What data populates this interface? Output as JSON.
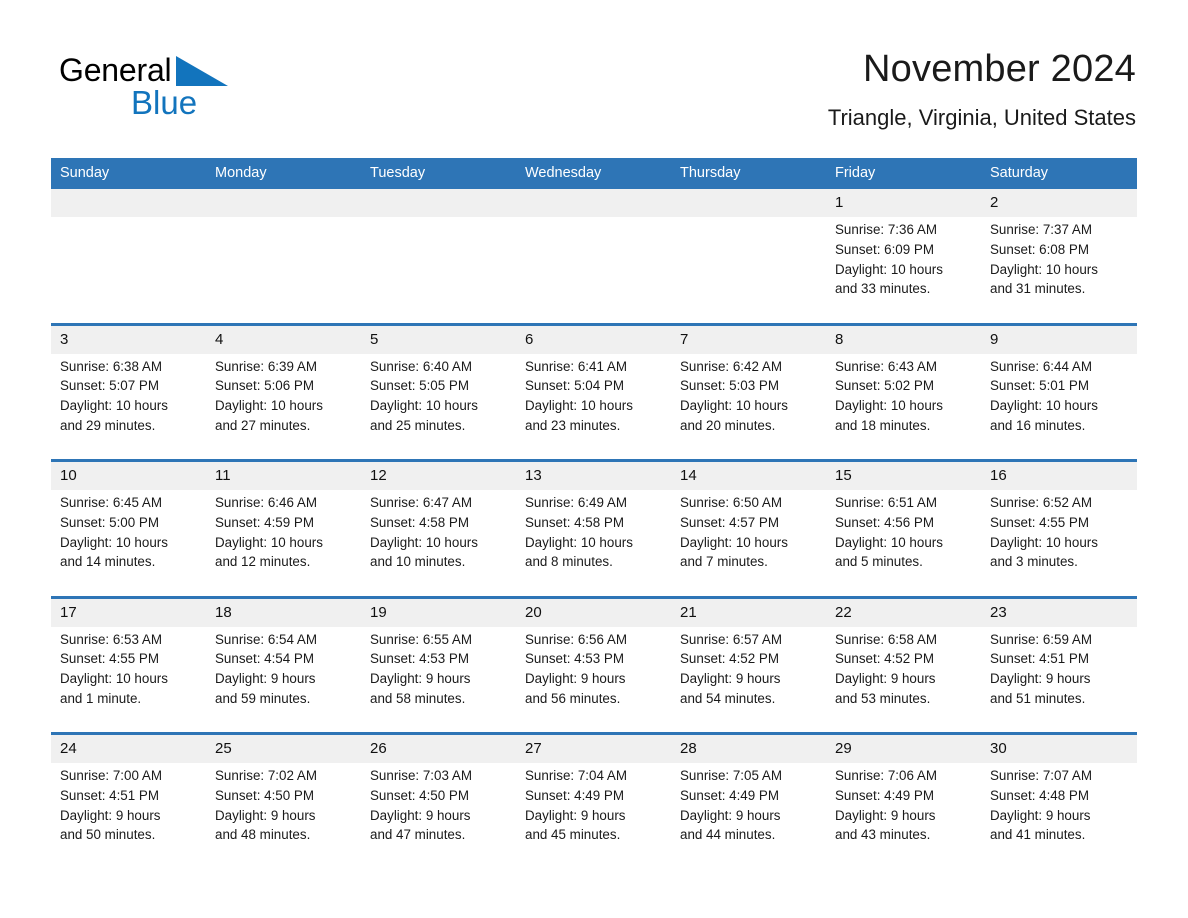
{
  "brand": {
    "name_part1": "General",
    "name_part2": "Blue",
    "triangle_icon": "blue-right-triangle",
    "accent_color": "#1274bd"
  },
  "header": {
    "title": "November 2024",
    "location": "Triangle, Virginia, United States"
  },
  "theme": {
    "header_bar_color": "#2e75b6",
    "daynum_band_color": "#f0f0f0",
    "cell_bg_color": "#ffffff",
    "text_color": "#1a1a1a",
    "week_divider_color": "#2e75b6"
  },
  "calendar": {
    "month": "November",
    "year": "2024",
    "weekday_headers": [
      "Sunday",
      "Monday",
      "Tuesday",
      "Wednesday",
      "Thursday",
      "Friday",
      "Saturday"
    ],
    "weeks": [
      [
        {
          "day": "",
          "lines": []
        },
        {
          "day": "",
          "lines": []
        },
        {
          "day": "",
          "lines": []
        },
        {
          "day": "",
          "lines": []
        },
        {
          "day": "",
          "lines": []
        },
        {
          "day": "1",
          "lines": [
            "Sunrise: 7:36 AM",
            "Sunset: 6:09 PM",
            "Daylight: 10 hours",
            "and 33 minutes."
          ]
        },
        {
          "day": "2",
          "lines": [
            "Sunrise: 7:37 AM",
            "Sunset: 6:08 PM",
            "Daylight: 10 hours",
            "and 31 minutes."
          ]
        }
      ],
      [
        {
          "day": "3",
          "lines": [
            "Sunrise: 6:38 AM",
            "Sunset: 5:07 PM",
            "Daylight: 10 hours",
            "and 29 minutes."
          ]
        },
        {
          "day": "4",
          "lines": [
            "Sunrise: 6:39 AM",
            "Sunset: 5:06 PM",
            "Daylight: 10 hours",
            "and 27 minutes."
          ]
        },
        {
          "day": "5",
          "lines": [
            "Sunrise: 6:40 AM",
            "Sunset: 5:05 PM",
            "Daylight: 10 hours",
            "and 25 minutes."
          ]
        },
        {
          "day": "6",
          "lines": [
            "Sunrise: 6:41 AM",
            "Sunset: 5:04 PM",
            "Daylight: 10 hours",
            "and 23 minutes."
          ]
        },
        {
          "day": "7",
          "lines": [
            "Sunrise: 6:42 AM",
            "Sunset: 5:03 PM",
            "Daylight: 10 hours",
            "and 20 minutes."
          ]
        },
        {
          "day": "8",
          "lines": [
            "Sunrise: 6:43 AM",
            "Sunset: 5:02 PM",
            "Daylight: 10 hours",
            "and 18 minutes."
          ]
        },
        {
          "day": "9",
          "lines": [
            "Sunrise: 6:44 AM",
            "Sunset: 5:01 PM",
            "Daylight: 10 hours",
            "and 16 minutes."
          ]
        }
      ],
      [
        {
          "day": "10",
          "lines": [
            "Sunrise: 6:45 AM",
            "Sunset: 5:00 PM",
            "Daylight: 10 hours",
            "and 14 minutes."
          ]
        },
        {
          "day": "11",
          "lines": [
            "Sunrise: 6:46 AM",
            "Sunset: 4:59 PM",
            "Daylight: 10 hours",
            "and 12 minutes."
          ]
        },
        {
          "day": "12",
          "lines": [
            "Sunrise: 6:47 AM",
            "Sunset: 4:58 PM",
            "Daylight: 10 hours",
            "and 10 minutes."
          ]
        },
        {
          "day": "13",
          "lines": [
            "Sunrise: 6:49 AM",
            "Sunset: 4:58 PM",
            "Daylight: 10 hours",
            "and 8 minutes."
          ]
        },
        {
          "day": "14",
          "lines": [
            "Sunrise: 6:50 AM",
            "Sunset: 4:57 PM",
            "Daylight: 10 hours",
            "and 7 minutes."
          ]
        },
        {
          "day": "15",
          "lines": [
            "Sunrise: 6:51 AM",
            "Sunset: 4:56 PM",
            "Daylight: 10 hours",
            "and 5 minutes."
          ]
        },
        {
          "day": "16",
          "lines": [
            "Sunrise: 6:52 AM",
            "Sunset: 4:55 PM",
            "Daylight: 10 hours",
            "and 3 minutes."
          ]
        }
      ],
      [
        {
          "day": "17",
          "lines": [
            "Sunrise: 6:53 AM",
            "Sunset: 4:55 PM",
            "Daylight: 10 hours",
            "and 1 minute."
          ]
        },
        {
          "day": "18",
          "lines": [
            "Sunrise: 6:54 AM",
            "Sunset: 4:54 PM",
            "Daylight: 9 hours",
            "and 59 minutes."
          ]
        },
        {
          "day": "19",
          "lines": [
            "Sunrise: 6:55 AM",
            "Sunset: 4:53 PM",
            "Daylight: 9 hours",
            "and 58 minutes."
          ]
        },
        {
          "day": "20",
          "lines": [
            "Sunrise: 6:56 AM",
            "Sunset: 4:53 PM",
            "Daylight: 9 hours",
            "and 56 minutes."
          ]
        },
        {
          "day": "21",
          "lines": [
            "Sunrise: 6:57 AM",
            "Sunset: 4:52 PM",
            "Daylight: 9 hours",
            "and 54 minutes."
          ]
        },
        {
          "day": "22",
          "lines": [
            "Sunrise: 6:58 AM",
            "Sunset: 4:52 PM",
            "Daylight: 9 hours",
            "and 53 minutes."
          ]
        },
        {
          "day": "23",
          "lines": [
            "Sunrise: 6:59 AM",
            "Sunset: 4:51 PM",
            "Daylight: 9 hours",
            "and 51 minutes."
          ]
        }
      ],
      [
        {
          "day": "24",
          "lines": [
            "Sunrise: 7:00 AM",
            "Sunset: 4:51 PM",
            "Daylight: 9 hours",
            "and 50 minutes."
          ]
        },
        {
          "day": "25",
          "lines": [
            "Sunrise: 7:02 AM",
            "Sunset: 4:50 PM",
            "Daylight: 9 hours",
            "and 48 minutes."
          ]
        },
        {
          "day": "26",
          "lines": [
            "Sunrise: 7:03 AM",
            "Sunset: 4:50 PM",
            "Daylight: 9 hours",
            "and 47 minutes."
          ]
        },
        {
          "day": "27",
          "lines": [
            "Sunrise: 7:04 AM",
            "Sunset: 4:49 PM",
            "Daylight: 9 hours",
            "and 45 minutes."
          ]
        },
        {
          "day": "28",
          "lines": [
            "Sunrise: 7:05 AM",
            "Sunset: 4:49 PM",
            "Daylight: 9 hours",
            "and 44 minutes."
          ]
        },
        {
          "day": "29",
          "lines": [
            "Sunrise: 7:06 AM",
            "Sunset: 4:49 PM",
            "Daylight: 9 hours",
            "and 43 minutes."
          ]
        },
        {
          "day": "30",
          "lines": [
            "Sunrise: 7:07 AM",
            "Sunset: 4:48 PM",
            "Daylight: 9 hours",
            "and 41 minutes."
          ]
        }
      ]
    ]
  }
}
